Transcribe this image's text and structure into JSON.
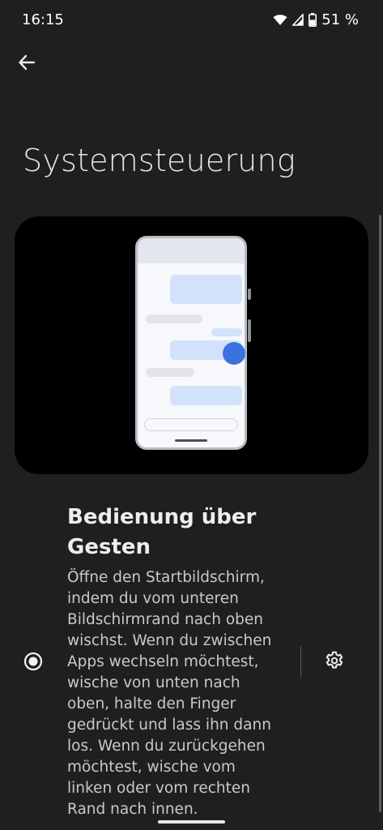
{
  "status_bar": {
    "time": "16:15",
    "battery": "51 %",
    "icons": [
      "wifi-icon",
      "signal-icon",
      "battery-icon"
    ]
  },
  "toolbar": {
    "back_icon": "arrow-back-icon"
  },
  "page": {
    "title": "Systemsteuerung"
  },
  "illustration": {
    "description_icon": "phone-gesture-illustration",
    "accent_color": "#3b72df"
  },
  "option": {
    "selected": true,
    "title": "Bedienung über Gesten",
    "description": "Öffne den Startbildschirm, indem du vom unteren Bildschirmrand nach oben wischst. Wenn du zwischen Apps wechseln möchtest, wische von unten nach oben, halte den Finger gedrückt und lass ihn dann los. Wenn du zurückgehen möchtest, wische vom linken oder vom rechten Rand nach innen.",
    "settings_icon": "gear-icon"
  },
  "colors": {
    "background": "#1f1f21",
    "card": "#000000",
    "text_primary": "#eeeef1",
    "text_secondary": "#c9c9cd"
  }
}
